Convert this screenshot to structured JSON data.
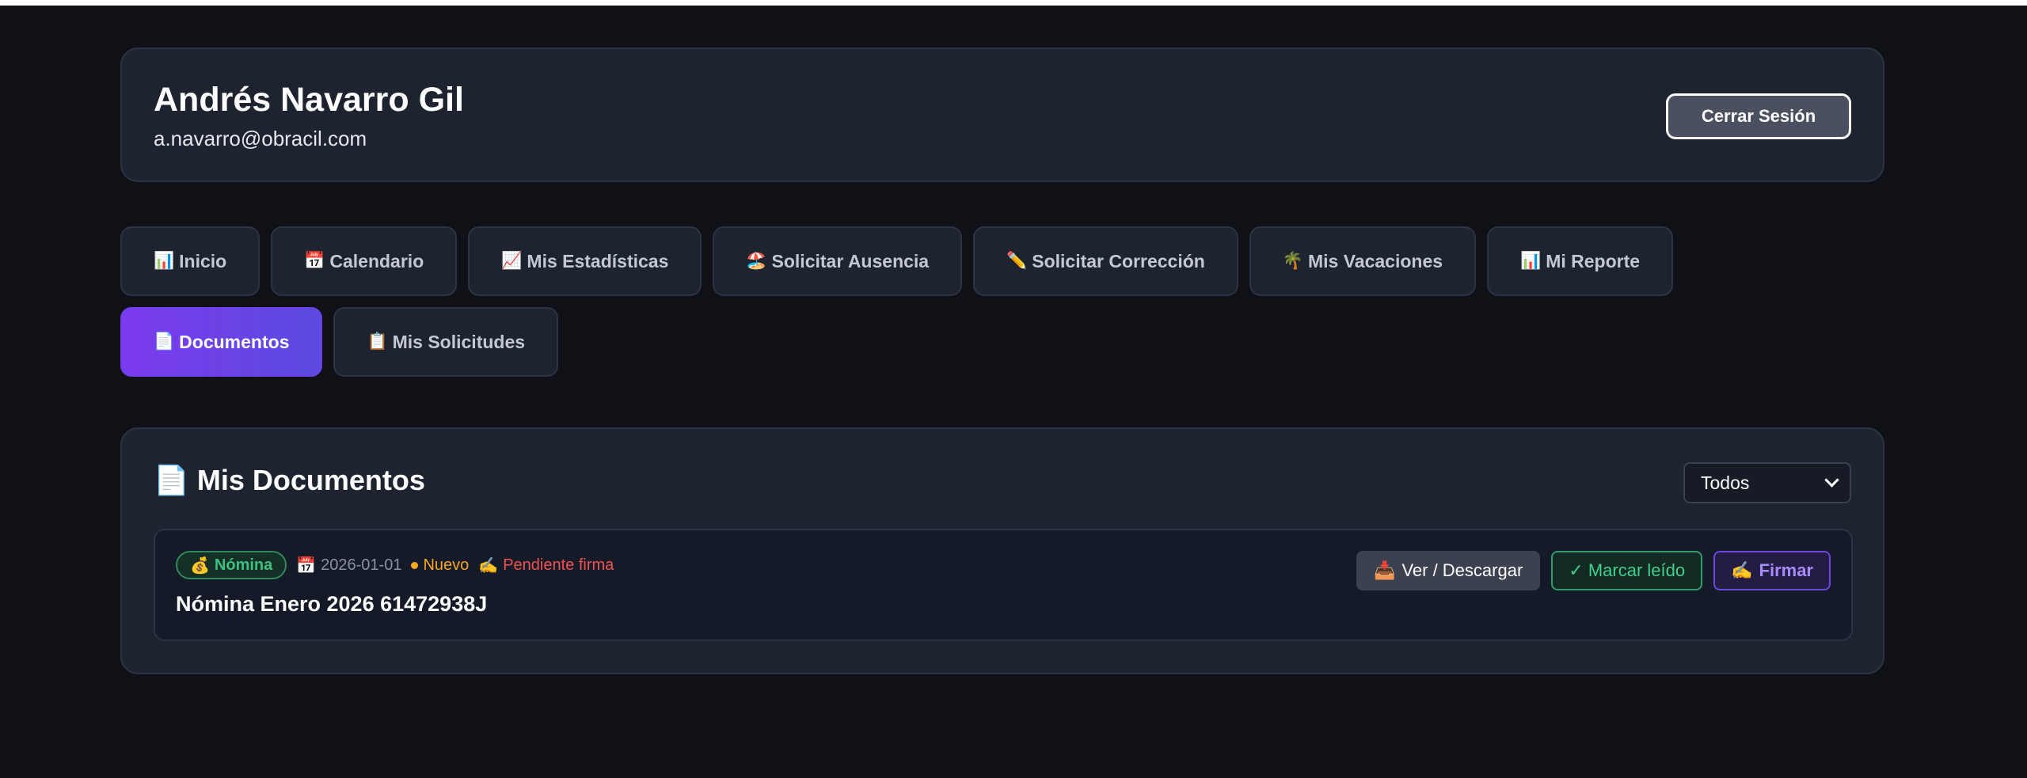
{
  "header": {
    "user_name": "Andrés Navarro Gil",
    "user_email": "a.navarro@obracil.com",
    "logout_label": "Cerrar Sesión"
  },
  "nav": {
    "tabs": [
      {
        "icon": "📊",
        "icon_name": "chart-icon",
        "label": "Inicio",
        "active": false
      },
      {
        "icon": "📅",
        "icon_name": "calendar-icon",
        "label": "Calendario",
        "active": false
      },
      {
        "icon": "📈",
        "icon_name": "trend-chart-icon",
        "label": "Mis Estadísticas",
        "active": false
      },
      {
        "icon": "🏖️",
        "icon_name": "beach-icon",
        "label": "Solicitar Ausencia",
        "active": false
      },
      {
        "icon": "✏️",
        "icon_name": "pencil-icon",
        "label": "Solicitar Corrección",
        "active": false
      },
      {
        "icon": "🌴",
        "icon_name": "palm-tree-icon",
        "label": "Mis Vacaciones",
        "active": false
      },
      {
        "icon": "📊",
        "icon_name": "chart-icon",
        "label": "Mi Reporte",
        "active": false
      },
      {
        "icon": "📄",
        "icon_name": "document-icon",
        "label": "Documentos",
        "active": true
      },
      {
        "icon": "📋",
        "icon_name": "clipboard-icon",
        "label": "Mis Solicitudes",
        "active": false
      }
    ]
  },
  "documents": {
    "title_icon": "📄",
    "title": "Mis Documentos",
    "filter_value": "Todos",
    "items": [
      {
        "type_icon": "💰",
        "type_label": "Nómina",
        "date_icon": "📅",
        "date": "2026-01-01",
        "status_new": "Nuevo",
        "pending_icon": "✍️",
        "status_pending": "Pendiente firma",
        "title": "Nómina Enero 2026 61472938J",
        "actions": {
          "view_icon": "📥",
          "view_label": "Ver / Descargar",
          "read_label": "✓ Marcar leído",
          "sign_icon": "✍️",
          "sign_label": "Firmar"
        }
      }
    ]
  },
  "colors": {
    "background": "#0f1117",
    "card": "#1e2330",
    "accent": "#7c3aed",
    "success": "#3fd08c",
    "warning": "#f5a623",
    "danger": "#ef5350"
  }
}
